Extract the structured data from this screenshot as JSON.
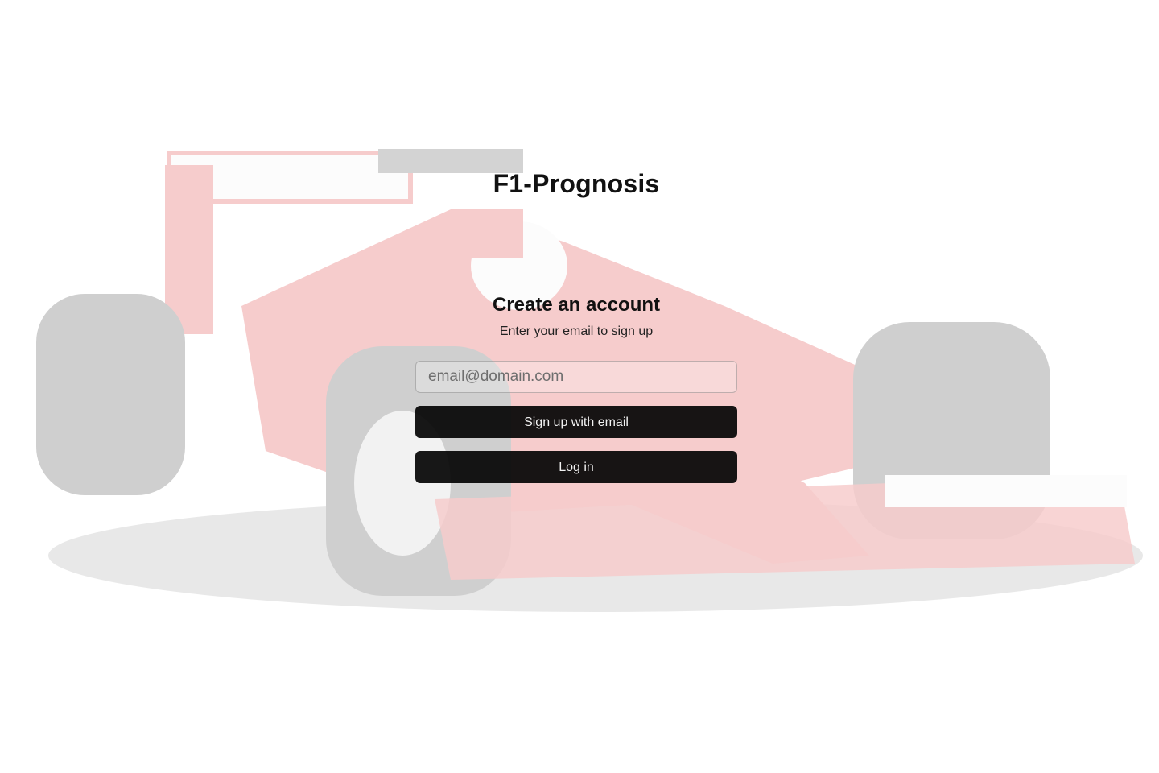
{
  "app": {
    "title": "F1-Prognosis"
  },
  "signup": {
    "heading": "Create an account",
    "subheading": "Enter your email to sign up",
    "email_placeholder": "email@domain.com",
    "email_value": "",
    "signup_label": "Sign up with email",
    "login_label": "Log in"
  },
  "background": {
    "image": "f1-car-image",
    "colors": {
      "livery_red": "#d81c1c",
      "tyre_dark": "#2a2a2a",
      "wing_white": "#f4f4f4"
    }
  }
}
